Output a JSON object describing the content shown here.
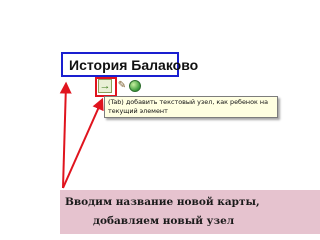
{
  "mind_map": {
    "node_title": "История Балаково"
  },
  "toolbar": {
    "buttons": [
      {
        "name": "add-child-node",
        "icon": "arrow-right-icon"
      },
      {
        "name": "edit",
        "icon": "pencil-icon"
      },
      {
        "name": "globe",
        "icon": "globe-icon"
      }
    ]
  },
  "tooltip": {
    "text": "(Tab) добавить текстовый узел, как ребенок на текущий элемент"
  },
  "caption": {
    "line1": "Вводим  название новой карты,",
    "line2": "добавляем новый узел"
  },
  "colors": {
    "node_border": "#1a1fd0",
    "highlight": "#e0141e",
    "arrow": "#e0141e",
    "caption_bg": "#e6c3cf",
    "tooltip_bg": "#ffffe1"
  }
}
